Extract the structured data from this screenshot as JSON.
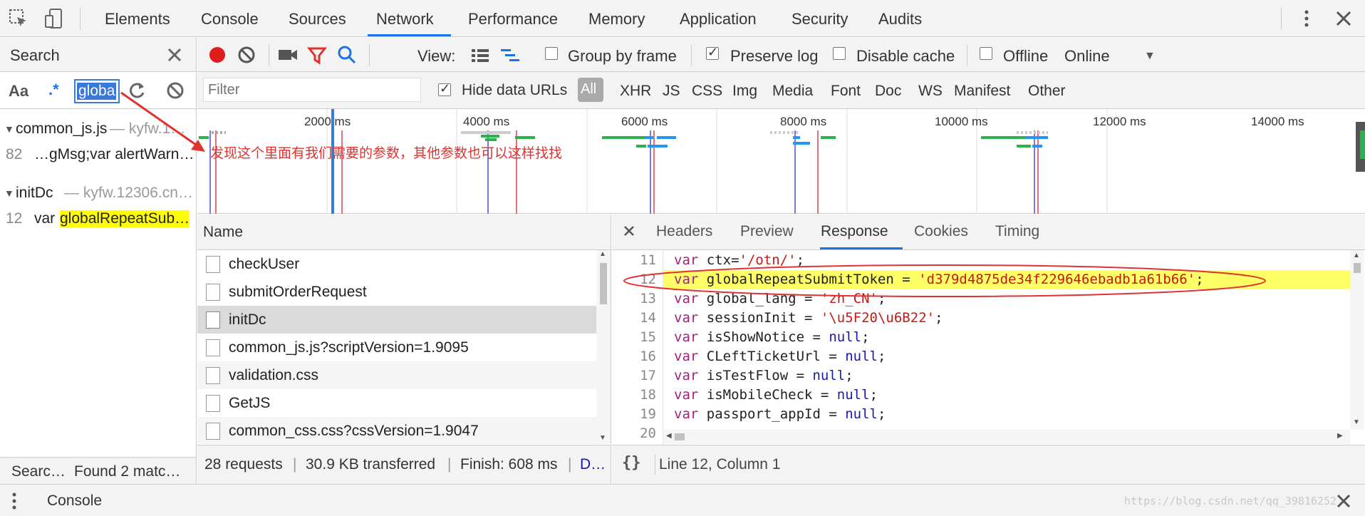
{
  "topbar": {
    "tabs": [
      "Elements",
      "Console",
      "Sources",
      "Network",
      "Performance",
      "Memory",
      "Application",
      "Security",
      "Audits"
    ],
    "active_tab": "Network"
  },
  "search": {
    "title": "Search",
    "match_case": "Aa",
    "regex": ".*",
    "query": "globa",
    "results": [
      {
        "file": "common_js.js",
        "origin": "— kyfw.1…",
        "line": "82",
        "snippet_pre": "…gMsg;var alertWarn…",
        "snippet_hl": ""
      },
      {
        "file": "initDc",
        "origin": "— kyfw.12306.cn…",
        "line": "12",
        "snippet_pre": "var ",
        "snippet_hl": "globalRepeatSub…"
      }
    ],
    "footer_left": "Searc…",
    "footer_status": "Found 2 matc…"
  },
  "annotation": {
    "text": "发现这个里面有我们需要的参数，其他参数也可以这样找找",
    "color": "#e0322e"
  },
  "toolbar": {
    "view_label": "View:",
    "group_by_frame": "Group by frame",
    "preserve_log": "Preserve log",
    "disable_cache": "Disable cache",
    "offline": "Offline",
    "throttle": "Online"
  },
  "filterbar": {
    "placeholder": "Filter",
    "hide_data_urls": "Hide data URLs",
    "types": [
      "All",
      "XHR",
      "JS",
      "CSS",
      "Img",
      "Media",
      "Font",
      "Doc",
      "WS",
      "Manifest",
      "Other"
    ]
  },
  "timeline": {
    "ticks": [
      "2000 ms",
      "4000 ms",
      "6000 ms",
      "8000 ms",
      "10000 ms",
      "12000 ms",
      "14000 ms"
    ]
  },
  "requests": {
    "header": "Name",
    "items": [
      "checkUser",
      "submitOrderRequest",
      "initDc",
      "common_js.js?scriptVersion=1.9095",
      "validation.css",
      "GetJS",
      "common_css.css?cssVersion=1.9047"
    ],
    "selected": "initDc",
    "footer": {
      "requests": "28 requests",
      "transferred": "30.9 KB transferred",
      "finish": "Finish: 608 ms",
      "more": "D…"
    }
  },
  "response": {
    "tabs": [
      "Headers",
      "Preview",
      "Response",
      "Cookies",
      "Timing"
    ],
    "active_tab": "Response",
    "lines": [
      {
        "n": "11",
        "kw": "var",
        "name": " ctx=",
        "val": "'/otn/'",
        "end": ";",
        "type": "str"
      },
      {
        "n": "12",
        "kw": "var",
        "name": " globalRepeatSubmitToken = ",
        "val": "'d379d4875de34f229646ebadb1a61b66'",
        "end": ";",
        "type": "str"
      },
      {
        "n": "13",
        "kw": "var",
        "name": " global_lang = ",
        "val": "'zh_CN'",
        "end": ";",
        "type": "str"
      },
      {
        "n": "14",
        "kw": "var",
        "name": " sessionInit = ",
        "val": "'\\u5F20\\u6B22'",
        "end": ";",
        "type": "str"
      },
      {
        "n": "15",
        "kw": "var",
        "name": " isShowNotice = ",
        "val": "null",
        "end": ";",
        "type": "nul"
      },
      {
        "n": "16",
        "kw": "var",
        "name": " CLeftTicketUrl = ",
        "val": "null",
        "end": ";",
        "type": "nul"
      },
      {
        "n": "17",
        "kw": "var",
        "name": " isTestFlow = ",
        "val": "null",
        "end": ";",
        "type": "nul"
      },
      {
        "n": "18",
        "kw": "var",
        "name": " isMobileCheck = ",
        "val": "null",
        "end": ";",
        "type": "nul"
      },
      {
        "n": "19",
        "kw": "var",
        "name": " passport_appId = ",
        "val": "null",
        "end": ";",
        "type": "nul"
      },
      {
        "n": "20",
        "kw": "",
        "name": "",
        "val": "",
        "end": "",
        "type": "str"
      }
    ],
    "status": "Line 12, Column 1",
    "format_icon": "{}"
  },
  "drawer": {
    "label": "Console"
  },
  "watermark": "https://blog.csdn.net/qq_39816252"
}
